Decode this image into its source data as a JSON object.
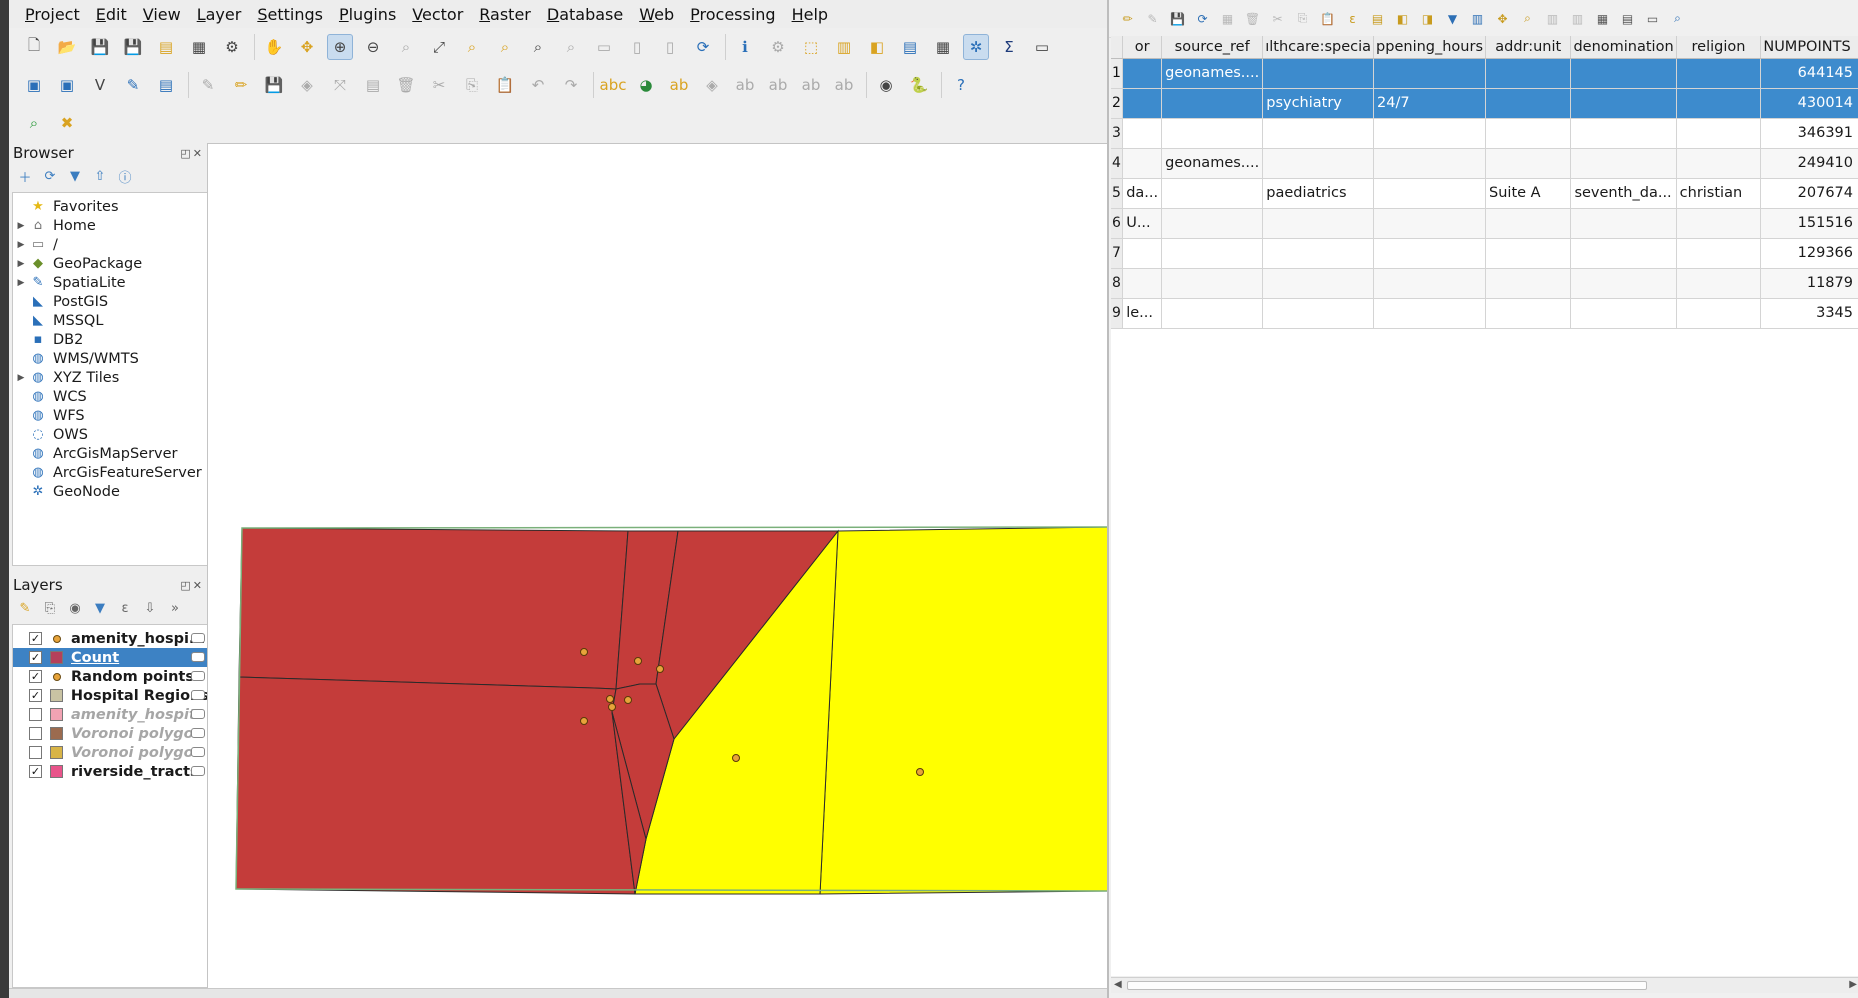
{
  "menubar": [
    "Project",
    "Edit",
    "View",
    "Layer",
    "Settings",
    "Plugins",
    "Vector",
    "Raster",
    "Database",
    "Web",
    "Processing",
    "Help"
  ],
  "browser": {
    "title": "Browser",
    "items": [
      {
        "label": "Favorites",
        "expandable": false,
        "icon": "star-icon"
      },
      {
        "label": "Home",
        "expandable": true,
        "icon": "home-folder-icon"
      },
      {
        "label": "/",
        "expandable": true,
        "icon": "folder-icon"
      },
      {
        "label": "GeoPackage",
        "expandable": true,
        "icon": "geopackage-icon"
      },
      {
        "label": "SpatiaLite",
        "expandable": true,
        "icon": "spatialite-icon"
      },
      {
        "label": "PostGIS",
        "expandable": false,
        "icon": "postgis-icon"
      },
      {
        "label": "MSSQL",
        "expandable": false,
        "icon": "mssql-icon"
      },
      {
        "label": "DB2",
        "expandable": false,
        "icon": "db2-icon"
      },
      {
        "label": "WMS/WMTS",
        "expandable": false,
        "icon": "globe-icon"
      },
      {
        "label": "XYZ Tiles",
        "expandable": true,
        "icon": "globe-icon"
      },
      {
        "label": "WCS",
        "expandable": false,
        "icon": "globe-icon"
      },
      {
        "label": "WFS",
        "expandable": false,
        "icon": "wfs-icon"
      },
      {
        "label": "OWS",
        "expandable": false,
        "icon": "globe-outline-icon"
      },
      {
        "label": "ArcGisMapServer",
        "expandable": false,
        "icon": "globe-icon"
      },
      {
        "label": "ArcGisFeatureServer",
        "expandable": false,
        "icon": "globe-icon"
      },
      {
        "label": "GeoNode",
        "expandable": false,
        "icon": "geonode-icon"
      }
    ]
  },
  "layers": {
    "title": "Layers",
    "items": [
      {
        "label": "amenity_hospi...",
        "checked": true,
        "symbol": "point",
        "color": "#e7a33a",
        "dim": false,
        "selected": false
      },
      {
        "label": "Count",
        "checked": true,
        "symbol": "fill",
        "color": "#b5405a",
        "dim": false,
        "selected": true
      },
      {
        "label": "Random points",
        "checked": true,
        "symbol": "point",
        "color": "#e7a33a",
        "dim": false,
        "selected": false
      },
      {
        "label": "Hospital Regions",
        "checked": true,
        "symbol": "fill",
        "color": "#c9c3a3",
        "dim": false,
        "selected": false
      },
      {
        "label": "amenity_hospit",
        "checked": false,
        "symbol": "fill",
        "color": "#f2a3b3",
        "dim": true,
        "selected": false
      },
      {
        "label": "Voronoi polygo",
        "checked": false,
        "symbol": "fill",
        "color": "#9b6b4f",
        "dim": true,
        "selected": false
      },
      {
        "label": "Voronoi polygo",
        "checked": false,
        "symbol": "fill",
        "color": "#d8b447",
        "dim": true,
        "selected": false
      },
      {
        "label": "riverside_tracts",
        "checked": true,
        "symbol": "fill",
        "color": "#e8548a",
        "dim": false,
        "selected": false
      }
    ]
  },
  "map": {
    "colors": {
      "red_region": "#c43c3a",
      "yellow_region": "#ffff00",
      "point": "#e7a33a",
      "outline": "#2a2a2a"
    }
  },
  "attribute_table": {
    "columns": [
      "or",
      "source_ref",
      "ılthcare:specia",
      "ppening_hours",
      "addr:unit",
      "denomination",
      "religion",
      "NUMPOINTS"
    ],
    "rows": [
      {
        "n": "1",
        "cells": [
          "",
          "geonames....",
          "",
          "",
          "",
          "",
          "",
          "644145"
        ],
        "selected": true
      },
      {
        "n": "2",
        "cells": [
          "",
          "",
          "psychiatry",
          "24/7",
          "",
          "",
          "",
          "430014"
        ],
        "selected": true
      },
      {
        "n": "3",
        "cells": [
          "",
          "",
          "",
          "",
          "",
          "",
          "",
          "346391"
        ],
        "selected": false
      },
      {
        "n": "4",
        "cells": [
          "",
          "geonames....",
          "",
          "",
          "",
          "",
          "",
          "249410"
        ],
        "selected": false
      },
      {
        "n": "5",
        "cells": [
          "da...",
          "",
          "paediatrics",
          "",
          "Suite A",
          "seventh_da...",
          "christian",
          "207674"
        ],
        "selected": false
      },
      {
        "n": "6",
        "cells": [
          "U...",
          "",
          "",
          "",
          "",
          "",
          "",
          "151516"
        ],
        "selected": false
      },
      {
        "n": "7",
        "cells": [
          "",
          "",
          "",
          "",
          "",
          "",
          "",
          "129366"
        ],
        "selected": false
      },
      {
        "n": "8",
        "cells": [
          "",
          "",
          "",
          "",
          "",
          "",
          "",
          "11879"
        ],
        "selected": false
      },
      {
        "n": "9",
        "cells": [
          "le...",
          "",
          "",
          "",
          "",
          "",
          "",
          "3345"
        ],
        "selected": false
      }
    ]
  }
}
